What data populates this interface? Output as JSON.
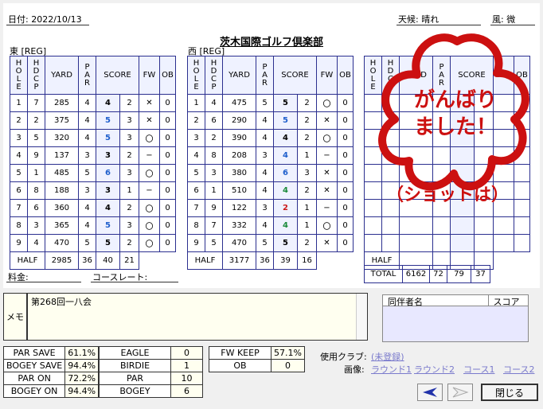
{
  "header": {
    "date": "日付: 2022/10/13",
    "weather": "天候: 晴れ",
    "wind": "風: 微",
    "club": "茨木国際ゴルフ倶楽部"
  },
  "course_out": {
    "caption": "東 [REG]"
  },
  "course_in": {
    "caption": "西 [REG]"
  },
  "columns": {
    "hole": "HOLE",
    "hdcp": "HDCP",
    "yard": "YARD",
    "par": "PAR",
    "score": "SCORE",
    "fw": "FW",
    "ob": "OB"
  },
  "out_rows": [
    {
      "hole": "1",
      "hdcp": "7",
      "yard": "285",
      "par": "4",
      "score": "4",
      "putt": "2",
      "fw": "✕",
      "ob": "0",
      "color": "#000"
    },
    {
      "hole": "2",
      "hdcp": "2",
      "yard": "375",
      "par": "4",
      "score": "5",
      "putt": "3",
      "fw": "✕",
      "ob": "0",
      "color": "#1f5fcc"
    },
    {
      "hole": "3",
      "hdcp": "5",
      "yard": "320",
      "par": "4",
      "score": "5",
      "putt": "3",
      "fw": "〇",
      "ob": "0",
      "color": "#1f5fcc"
    },
    {
      "hole": "4",
      "hdcp": "9",
      "yard": "137",
      "par": "3",
      "score": "3",
      "putt": "2",
      "fw": "−",
      "ob": "0",
      "color": "#000"
    },
    {
      "hole": "5",
      "hdcp": "1",
      "yard": "485",
      "par": "5",
      "score": "6",
      "putt": "3",
      "fw": "〇",
      "ob": "0",
      "color": "#1f5fcc"
    },
    {
      "hole": "6",
      "hdcp": "8",
      "yard": "188",
      "par": "3",
      "score": "3",
      "putt": "1",
      "fw": "−",
      "ob": "0",
      "color": "#000"
    },
    {
      "hole": "7",
      "hdcp": "6",
      "yard": "360",
      "par": "4",
      "score": "4",
      "putt": "2",
      "fw": "〇",
      "ob": "0",
      "color": "#000"
    },
    {
      "hole": "8",
      "hdcp": "3",
      "yard": "365",
      "par": "4",
      "score": "5",
      "putt": "3",
      "fw": "〇",
      "ob": "0",
      "color": "#1f5fcc"
    },
    {
      "hole": "9",
      "hdcp": "4",
      "yard": "470",
      "par": "5",
      "score": "5",
      "putt": "2",
      "fw": "〇",
      "ob": "0",
      "color": "#000"
    }
  ],
  "out_half": {
    "label": "HALF",
    "yard": "2985",
    "par": "36",
    "score": "40",
    "putt": "21"
  },
  "in_rows": [
    {
      "hole": "1",
      "hdcp": "4",
      "yard": "475",
      "par": "5",
      "score": "5",
      "putt": "2",
      "fw": "〇",
      "ob": "0",
      "color": "#000"
    },
    {
      "hole": "2",
      "hdcp": "6",
      "yard": "290",
      "par": "4",
      "score": "5",
      "putt": "2",
      "fw": "✕",
      "ob": "0",
      "color": "#1f5fcc"
    },
    {
      "hole": "3",
      "hdcp": "2",
      "yard": "390",
      "par": "4",
      "score": "4",
      "putt": "2",
      "fw": "〇",
      "ob": "0",
      "color": "#000"
    },
    {
      "hole": "4",
      "hdcp": "8",
      "yard": "208",
      "par": "3",
      "score": "4",
      "putt": "1",
      "fw": "−",
      "ob": "0",
      "color": "#1f5fcc"
    },
    {
      "hole": "5",
      "hdcp": "3",
      "yard": "380",
      "par": "4",
      "score": "6",
      "putt": "3",
      "fw": "✕",
      "ob": "0",
      "color": "#1f5fcc"
    },
    {
      "hole": "6",
      "hdcp": "1",
      "yard": "510",
      "par": "4",
      "score": "4",
      "putt": "2",
      "fw": "✕",
      "ob": "0",
      "color": "#1a8a3a"
    },
    {
      "hole": "7",
      "hdcp": "9",
      "yard": "122",
      "par": "3",
      "score": "2",
      "putt": "1",
      "fw": "−",
      "ob": "0",
      "color": "#cc1a1a"
    },
    {
      "hole": "8",
      "hdcp": "7",
      "yard": "332",
      "par": "4",
      "score": "4",
      "putt": "1",
      "fw": "〇",
      "ob": "0",
      "color": "#1a8a3a"
    },
    {
      "hole": "9",
      "hdcp": "5",
      "yard": "470",
      "par": "5",
      "score": "5",
      "putt": "2",
      "fw": "✕",
      "ob": "0",
      "color": "#000"
    }
  ],
  "in_half": {
    "label": "HALF",
    "yard": "3177",
    "par": "36",
    "score": "39",
    "putt": "16"
  },
  "third_half": {
    "label": "HALF"
  },
  "total": {
    "label": "TOTAL",
    "yard": "6162",
    "par": "72",
    "score": "79",
    "putt": "37"
  },
  "stamp": {
    "line1": "がんばり",
    "line2": "ました！",
    "line3": "（ショットは）"
  },
  "fee": {
    "label": "料金:",
    "course_rate": "コースレート:"
  },
  "memo": {
    "label": "メモ",
    "text": "第268回一八会"
  },
  "companions": {
    "col1": "同伴者名",
    "col2": "スコア"
  },
  "stats_left": [
    [
      "PAR SAVE",
      "61.1%"
    ],
    [
      "BOGEY SAVE",
      "94.4%"
    ],
    [
      "PAR ON",
      "72.2%"
    ],
    [
      "BOGEY ON",
      "94.4%"
    ]
  ],
  "stats_mid": [
    [
      "EAGLE",
      "0"
    ],
    [
      "BIRDIE",
      "1"
    ],
    [
      "PAR",
      "10"
    ],
    [
      "BOGEY",
      "6"
    ]
  ],
  "stats_right": [
    [
      "FW KEEP",
      "57.1%"
    ],
    [
      "OB",
      "0"
    ]
  ],
  "clubs": {
    "label": "使用クラブ:",
    "value": "(未登録)"
  },
  "images": {
    "label": "画像:",
    "r1": "ラウンド1",
    "r2": "ラウンド2",
    "c1": "コース1",
    "c2": "コース2"
  },
  "buttons": {
    "close": "閉じる"
  },
  "colors": {
    "table_border": "#2b2f8f",
    "stamp": "#cc1010"
  }
}
